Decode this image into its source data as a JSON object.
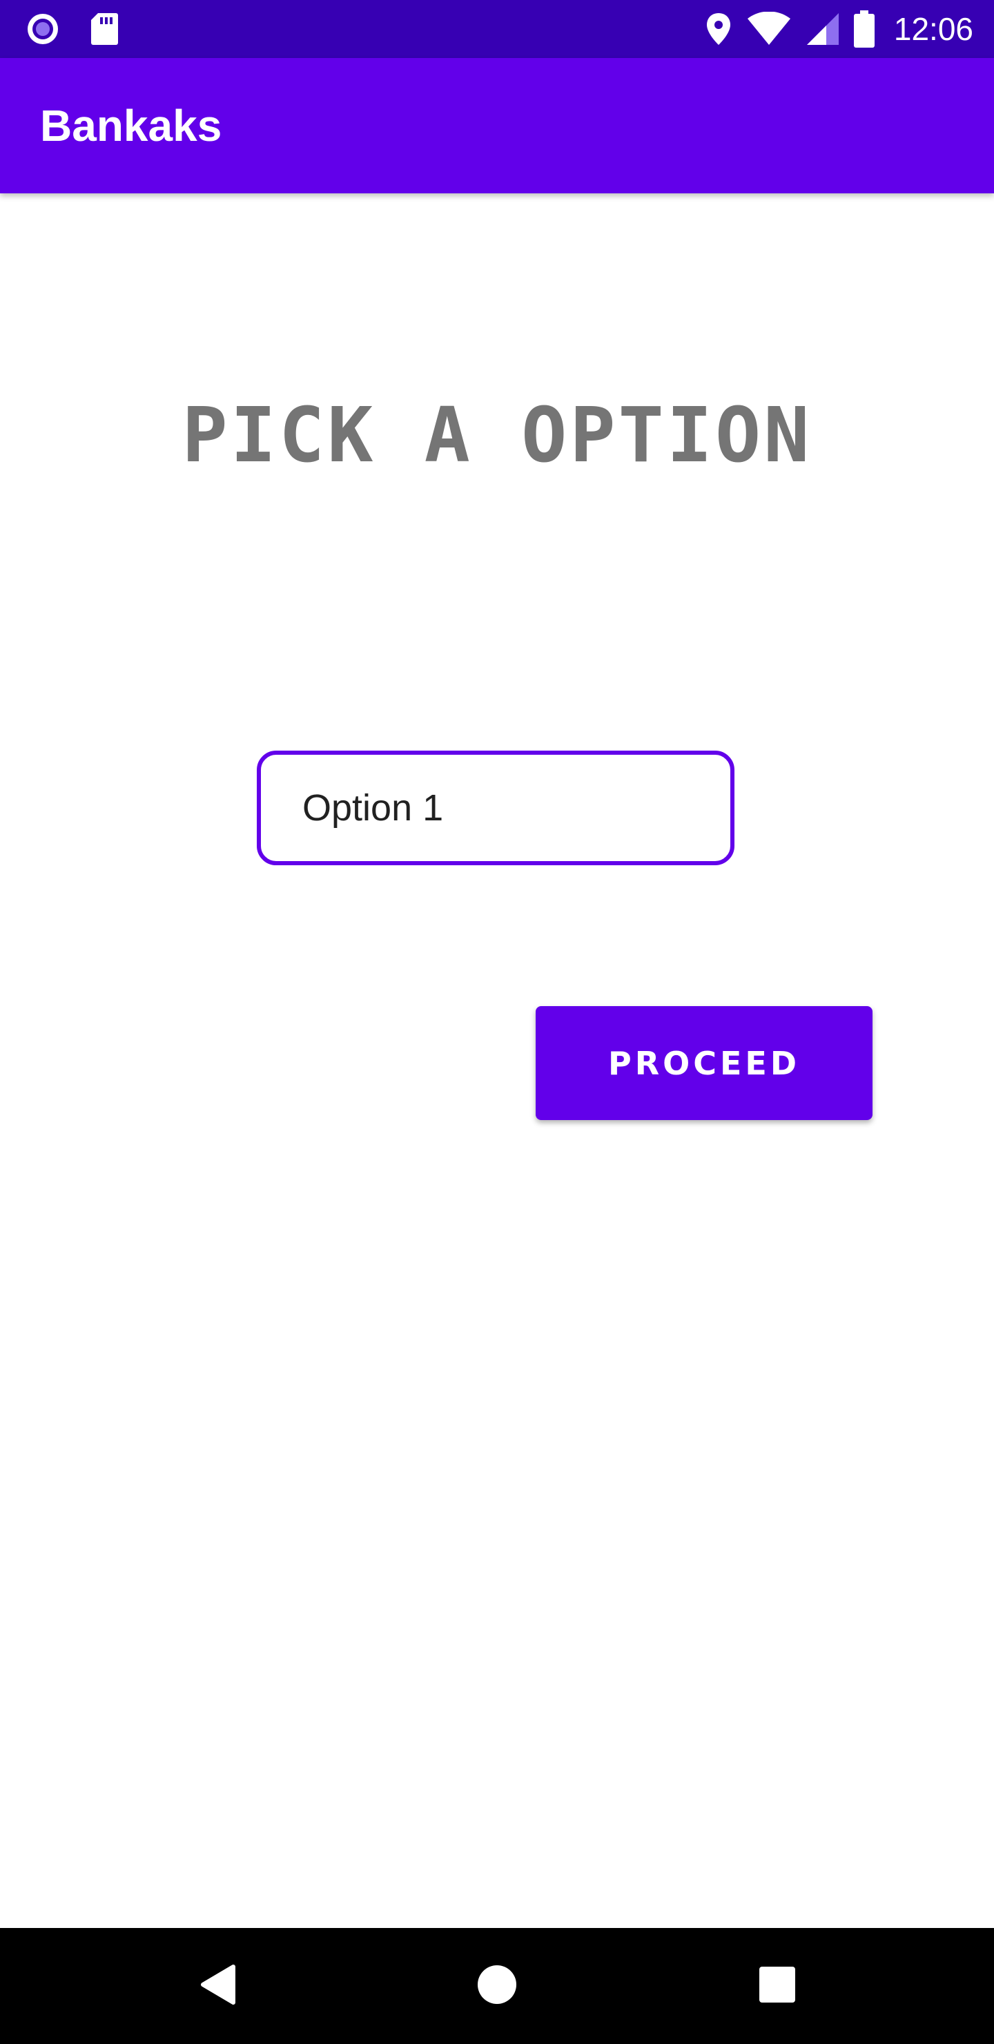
{
  "status_bar": {
    "time": "12:06",
    "icons": [
      "notification-icon",
      "sd-card-icon",
      "location-icon",
      "wifi-icon",
      "signal-icon",
      "battery-icon"
    ],
    "background_color": "#3700b3"
  },
  "app_bar": {
    "title": "Bankaks",
    "background_color": "#6200ea"
  },
  "main": {
    "heading": "PICK A OPTION",
    "option_field": {
      "value": "Option 1"
    },
    "proceed_button": {
      "label": "PROCEED"
    }
  },
  "nav_bar": {
    "buttons": [
      "back-icon",
      "home-icon",
      "recents-icon"
    ]
  },
  "colors": {
    "accent": "#6200ea",
    "heading_text": "#757575"
  }
}
